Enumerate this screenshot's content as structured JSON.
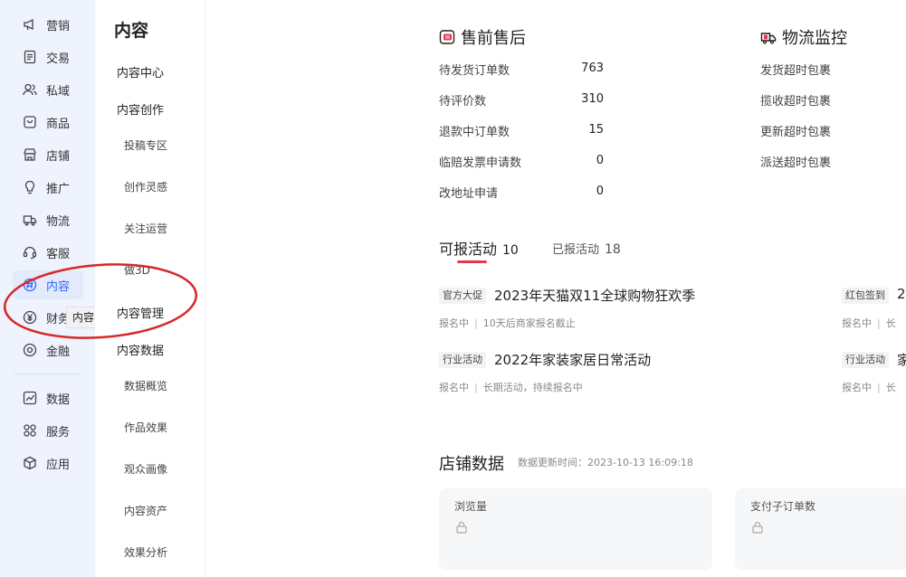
{
  "rail": {
    "items": [
      {
        "label": "营销",
        "icon": "megaphone-icon"
      },
      {
        "label": "交易",
        "icon": "document-icon"
      },
      {
        "label": "私域",
        "icon": "users-icon"
      },
      {
        "label": "商品",
        "icon": "goods-icon"
      },
      {
        "label": "店铺",
        "icon": "store-icon"
      },
      {
        "label": "推广",
        "icon": "bulb-icon"
      },
      {
        "label": "物流",
        "icon": "truck-icon"
      },
      {
        "label": "客服",
        "icon": "headset-icon"
      },
      {
        "label": "内容",
        "icon": "hash-icon",
        "active": true
      },
      {
        "label": "财务",
        "icon": "yen-icon"
      },
      {
        "label": "金融",
        "icon": "finance-icon"
      },
      {
        "label": "数据",
        "icon": "chart-icon"
      },
      {
        "label": "服务",
        "icon": "grid-icon"
      },
      {
        "label": "应用",
        "icon": "cube-icon"
      }
    ],
    "tooltip": "内容",
    "accent": "#3366ff"
  },
  "submenu": {
    "title": "内容",
    "items": [
      {
        "label": "内容中心",
        "kind": "group"
      },
      {
        "label": "内容创作",
        "kind": "group"
      },
      {
        "label": "投稿专区",
        "kind": "leaf"
      },
      {
        "label": "创作灵感",
        "kind": "leaf"
      },
      {
        "label": "关注运营",
        "kind": "leaf"
      },
      {
        "label": "做3D",
        "kind": "leaf"
      },
      {
        "label": "内容管理",
        "kind": "group"
      },
      {
        "label": "内容数据",
        "kind": "group"
      },
      {
        "label": "数据概览",
        "kind": "leaf"
      },
      {
        "label": "作品效果",
        "kind": "leaf"
      },
      {
        "label": "观众画像",
        "kind": "leaf"
      },
      {
        "label": "内容资产",
        "kind": "leaf"
      },
      {
        "label": "效果分析",
        "kind": "leaf"
      }
    ]
  },
  "after_sales": {
    "title": "售前售后",
    "stats": [
      {
        "label": "待发货订单数",
        "value": "763"
      },
      {
        "label": "待评价数",
        "value": "310"
      },
      {
        "label": "退款中订单数",
        "value": "15"
      },
      {
        "label": "临赔发票申请数",
        "value": "0"
      },
      {
        "label": "改地址申请",
        "value": "0"
      }
    ]
  },
  "logistics": {
    "title": "物流监控",
    "items": [
      "发货超时包裹",
      "揽收超时包裹",
      "更新超时包裹",
      "派送超时包裹"
    ]
  },
  "activities": {
    "tabs": [
      {
        "label": "可报活动",
        "count": "10"
      },
      {
        "label": "已报活动",
        "count": "18"
      }
    ],
    "underline_color": "#e8344e",
    "items": [
      {
        "tag": "官方大促",
        "title": "2023年天猫双11全球购物狂欢季",
        "status": "报名中",
        "note": "10天后商家报名截止"
      },
      {
        "tag": "行业活动",
        "title": "2022年家装家居日常活动",
        "status": "报名中",
        "note": "长期活动，持续报名中"
      },
      {
        "tag": "红包签到",
        "title": "2",
        "status": "报名中",
        "note": "长"
      },
      {
        "tag": "行业活动",
        "title": "家",
        "status": "报名中",
        "note": "长"
      }
    ]
  },
  "store_data": {
    "title": "店铺数据",
    "updated": "数据更新时间：2023-10-13 16:09:18",
    "cards": [
      {
        "label": "浏览量"
      },
      {
        "label": "支付子订单数"
      }
    ]
  }
}
